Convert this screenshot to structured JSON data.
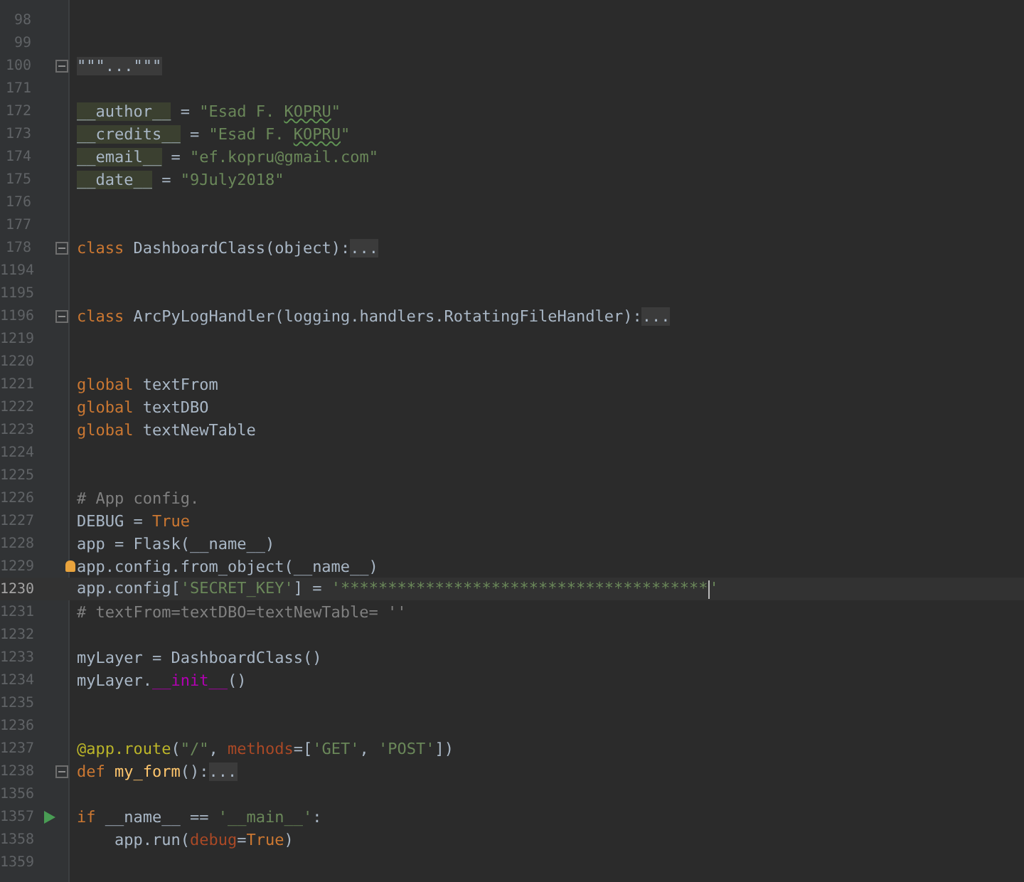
{
  "lines": [
    {
      "number": "98",
      "current": false,
      "fold": false,
      "run": false,
      "hint": false
    },
    {
      "number": "99",
      "current": false,
      "fold": false,
      "run": false,
      "hint": false
    },
    {
      "number": "100",
      "current": false,
      "fold": true,
      "run": false,
      "hint": false,
      "tokens": [
        {
          "kind": "folded",
          "text": "\"\"\"...\"\"\""
        }
      ]
    },
    {
      "number": "171",
      "current": false,
      "fold": false,
      "run": false,
      "hint": false
    },
    {
      "number": "172",
      "current": false,
      "fold": false,
      "run": false,
      "hint": false,
      "tokens": [
        {
          "kind": "dunder",
          "text": "__author__"
        },
        {
          "kind": "plain",
          "text": " = "
        },
        {
          "kind": "string",
          "text": "\"Esad F. "
        },
        {
          "kind": "typo",
          "text": "KOPRU"
        },
        {
          "kind": "string",
          "text": "\""
        }
      ]
    },
    {
      "number": "173",
      "current": false,
      "fold": false,
      "run": false,
      "hint": false,
      "tokens": [
        {
          "kind": "dunder",
          "text": "__credits__"
        },
        {
          "kind": "plain",
          "text": " = "
        },
        {
          "kind": "string",
          "text": "\"Esad F. "
        },
        {
          "kind": "typo",
          "text": "KOPRU"
        },
        {
          "kind": "string",
          "text": "\""
        }
      ]
    },
    {
      "number": "174",
      "current": false,
      "fold": false,
      "run": false,
      "hint": false,
      "tokens": [
        {
          "kind": "dunder",
          "text": "__email__"
        },
        {
          "kind": "plain",
          "text": " = "
        },
        {
          "kind": "string",
          "text": "\"ef.kopru@gmail.com\""
        }
      ]
    },
    {
      "number": "175",
      "current": false,
      "fold": false,
      "run": false,
      "hint": false,
      "tokens": [
        {
          "kind": "dunder",
          "text": "__date__"
        },
        {
          "kind": "plain",
          "text": " = "
        },
        {
          "kind": "string",
          "text": "\"9July2018\""
        }
      ]
    },
    {
      "number": "176",
      "current": false,
      "fold": false,
      "run": false,
      "hint": false
    },
    {
      "number": "177",
      "current": false,
      "fold": false,
      "run": false,
      "hint": false
    },
    {
      "number": "178",
      "current": false,
      "fold": true,
      "run": false,
      "hint": false,
      "tokens": [
        {
          "kind": "keyword",
          "text": "class "
        },
        {
          "kind": "plain",
          "text": "DashboardClass(object):"
        },
        {
          "kind": "folded",
          "text": "..."
        }
      ]
    },
    {
      "number": "1194",
      "current": false,
      "fold": false,
      "run": false,
      "hint": false
    },
    {
      "number": "1195",
      "current": false,
      "fold": false,
      "run": false,
      "hint": false
    },
    {
      "number": "1196",
      "current": false,
      "fold": true,
      "run": false,
      "hint": false,
      "tokens": [
        {
          "kind": "keyword",
          "text": "class "
        },
        {
          "kind": "plain",
          "text": "ArcPyLogHandler(logging.handlers.RotatingFileHandler):"
        },
        {
          "kind": "folded",
          "text": "..."
        }
      ]
    },
    {
      "number": "1219",
      "current": false,
      "fold": false,
      "run": false,
      "hint": false
    },
    {
      "number": "1220",
      "current": false,
      "fold": false,
      "run": false,
      "hint": false
    },
    {
      "number": "1221",
      "current": false,
      "fold": false,
      "run": false,
      "hint": false,
      "tokens": [
        {
          "kind": "keyword",
          "text": "global "
        },
        {
          "kind": "plain",
          "text": "textFrom"
        }
      ]
    },
    {
      "number": "1222",
      "current": false,
      "fold": false,
      "run": false,
      "hint": false,
      "tokens": [
        {
          "kind": "keyword",
          "text": "global "
        },
        {
          "kind": "plain",
          "text": "textDBO"
        }
      ]
    },
    {
      "number": "1223",
      "current": false,
      "fold": false,
      "run": false,
      "hint": false,
      "tokens": [
        {
          "kind": "keyword",
          "text": "global "
        },
        {
          "kind": "plain",
          "text": "textNewTable"
        }
      ]
    },
    {
      "number": "1224",
      "current": false,
      "fold": false,
      "run": false,
      "hint": false
    },
    {
      "number": "1225",
      "current": false,
      "fold": false,
      "run": false,
      "hint": false
    },
    {
      "number": "1226",
      "current": false,
      "fold": false,
      "run": false,
      "hint": false,
      "tokens": [
        {
          "kind": "comment",
          "text": "# App config."
        }
      ]
    },
    {
      "number": "1227",
      "current": false,
      "fold": false,
      "run": false,
      "hint": false,
      "tokens": [
        {
          "kind": "plain",
          "text": "DEBUG = "
        },
        {
          "kind": "keyword",
          "text": "True"
        }
      ]
    },
    {
      "number": "1228",
      "current": false,
      "fold": false,
      "run": false,
      "hint": false,
      "tokens": [
        {
          "kind": "plain",
          "text": "app = Flask(__name__)"
        }
      ]
    },
    {
      "number": "1229",
      "current": false,
      "fold": false,
      "run": false,
      "hint": true,
      "tokens": [
        {
          "kind": "plain",
          "text": "app.config.from_object(__name__)"
        }
      ]
    },
    {
      "number": "1230",
      "current": true,
      "fold": false,
      "run": false,
      "hint": false,
      "tokens": [
        {
          "kind": "plain",
          "text": "app.config["
        },
        {
          "kind": "string",
          "text": "'SECRET_KEY'"
        },
        {
          "kind": "plain",
          "text": "] = "
        },
        {
          "kind": "string",
          "text": "'***************************************",
          "caret_after": true
        },
        {
          "kind": "string",
          "text": "'"
        }
      ]
    },
    {
      "number": "1231",
      "current": false,
      "fold": false,
      "run": false,
      "hint": false,
      "tokens": [
        {
          "kind": "comment",
          "text": "# textFrom=textDBO=textNewTable= ''"
        }
      ]
    },
    {
      "number": "1232",
      "current": false,
      "fold": false,
      "run": false,
      "hint": false
    },
    {
      "number": "1233",
      "current": false,
      "fold": false,
      "run": false,
      "hint": false,
      "tokens": [
        {
          "kind": "plain",
          "text": "myLayer = DashboardClass()"
        }
      ]
    },
    {
      "number": "1234",
      "current": false,
      "fold": false,
      "run": false,
      "hint": false,
      "tokens": [
        {
          "kind": "plain",
          "text": "myLayer."
        },
        {
          "kind": "magic",
          "text": "__init__"
        },
        {
          "kind": "plain",
          "text": "()"
        }
      ]
    },
    {
      "number": "1235",
      "current": false,
      "fold": false,
      "run": false,
      "hint": false
    },
    {
      "number": "1236",
      "current": false,
      "fold": false,
      "run": false,
      "hint": false
    },
    {
      "number": "1237",
      "current": false,
      "fold": false,
      "run": false,
      "hint": false,
      "tokens": [
        {
          "kind": "decorator",
          "text": "@app.route"
        },
        {
          "kind": "plain",
          "text": "("
        },
        {
          "kind": "string",
          "text": "\"/\""
        },
        {
          "kind": "plain",
          "text": ", "
        },
        {
          "kind": "param",
          "text": "methods"
        },
        {
          "kind": "plain",
          "text": "=["
        },
        {
          "kind": "string",
          "text": "'GET'"
        },
        {
          "kind": "plain",
          "text": ", "
        },
        {
          "kind": "string",
          "text": "'POST'"
        },
        {
          "kind": "plain",
          "text": "])"
        }
      ]
    },
    {
      "number": "1238",
      "current": false,
      "fold": true,
      "run": false,
      "hint": false,
      "tokens": [
        {
          "kind": "keyword",
          "text": "def "
        },
        {
          "kind": "function",
          "text": "my_form"
        },
        {
          "kind": "plain",
          "text": "():"
        },
        {
          "kind": "folded",
          "text": "..."
        }
      ]
    },
    {
      "number": "1356",
      "current": false,
      "fold": false,
      "run": false,
      "hint": false
    },
    {
      "number": "1357",
      "current": false,
      "fold": false,
      "run": true,
      "hint": false,
      "tokens": [
        {
          "kind": "keyword",
          "text": "if "
        },
        {
          "kind": "plain",
          "text": "__name__ == "
        },
        {
          "kind": "string",
          "text": "'__main__'"
        },
        {
          "kind": "plain",
          "text": ":"
        }
      ]
    },
    {
      "number": "1358",
      "current": false,
      "fold": false,
      "run": false,
      "hint": false,
      "tokens": [
        {
          "kind": "plain",
          "text": "    app.run("
        },
        {
          "kind": "param",
          "text": "debug"
        },
        {
          "kind": "plain",
          "text": "="
        },
        {
          "kind": "keyword",
          "text": "True"
        },
        {
          "kind": "plain",
          "text": ")"
        }
      ]
    },
    {
      "number": "1359",
      "current": false,
      "fold": false,
      "run": false,
      "hint": false
    }
  ]
}
